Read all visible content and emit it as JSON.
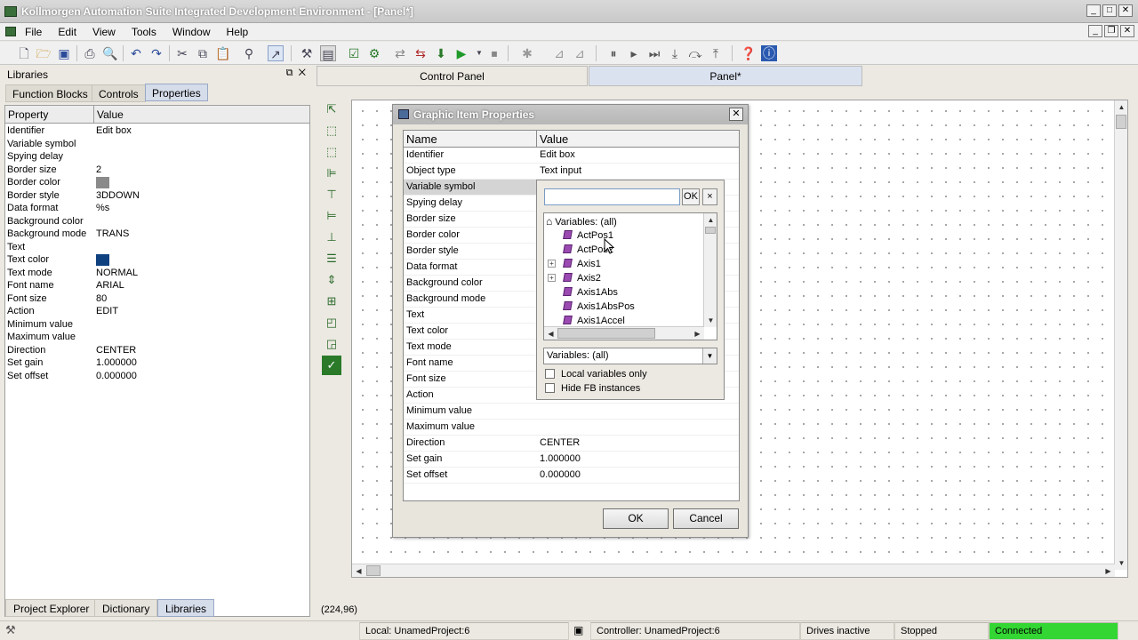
{
  "window": {
    "title": "Kollmorgen Automation Suite Integrated Development Environment - [Panel*]"
  },
  "menu": {
    "items": [
      "File",
      "Edit",
      "View",
      "Tools",
      "Window",
      "Help"
    ]
  },
  "libraries": {
    "title": "Libraries",
    "tabs": [
      "Function Blocks",
      "Controls",
      "Properties"
    ],
    "grid_headers": [
      "Property",
      "Value"
    ],
    "rows": [
      {
        "name": "Identifier",
        "value": "Edit box"
      },
      {
        "name": "Variable symbol",
        "value": ""
      },
      {
        "name": "Spying delay",
        "value": ""
      },
      {
        "name": "Border size",
        "value": "2"
      },
      {
        "name": "Border color",
        "value": ""
      },
      {
        "name": "Border style",
        "value": "3DDOWN"
      },
      {
        "name": "Data format",
        "value": "%s"
      },
      {
        "name": "Background color",
        "value": ""
      },
      {
        "name": "Background mode",
        "value": "TRANS"
      },
      {
        "name": "Text",
        "value": ""
      },
      {
        "name": "Text color",
        "value": ""
      },
      {
        "name": "Text mode",
        "value": "NORMAL"
      },
      {
        "name": "Font name",
        "value": "ARIAL"
      },
      {
        "name": "Font size",
        "value": "80"
      },
      {
        "name": "Action",
        "value": "EDIT"
      },
      {
        "name": "Minimum value",
        "value": ""
      },
      {
        "name": "Maximum value",
        "value": ""
      },
      {
        "name": "Direction",
        "value": "CENTER"
      },
      {
        "name": "Set gain",
        "value": "1.000000"
      },
      {
        "name": "Set offset",
        "value": "0.000000"
      }
    ],
    "colors": {
      "border_color": "#8a8a8a",
      "text_color": "#0f4080"
    }
  },
  "bottom_tabs": [
    "Project Explorer",
    "Dictionary",
    "Libraries"
  ],
  "doc_tabs": [
    "Control Panel",
    "Panel*"
  ],
  "coords": "(224,96)",
  "dialog": {
    "title": "Graphic Item Properties",
    "headers": [
      "Name",
      "Value"
    ],
    "rows": [
      {
        "name": "Identifier",
        "value": "Edit box"
      },
      {
        "name": "Object type",
        "value": "Text input"
      },
      {
        "name": "Variable symbol",
        "value": ""
      },
      {
        "name": "Spying delay",
        "value": ""
      },
      {
        "name": "Border size",
        "value": ""
      },
      {
        "name": "Border color",
        "value": ""
      },
      {
        "name": "Border style",
        "value": ""
      },
      {
        "name": "Data format",
        "value": ""
      },
      {
        "name": "Background color",
        "value": ""
      },
      {
        "name": "Background mode",
        "value": ""
      },
      {
        "name": "Text",
        "value": ""
      },
      {
        "name": "Text color",
        "value": ""
      },
      {
        "name": "Text mode",
        "value": ""
      },
      {
        "name": "Font name",
        "value": ""
      },
      {
        "name": "Font size",
        "value": ""
      },
      {
        "name": "Action",
        "value": ""
      },
      {
        "name": "Minimum value",
        "value": ""
      },
      {
        "name": "Maximum value",
        "value": ""
      },
      {
        "name": "Direction",
        "value": "CENTER"
      },
      {
        "name": "Set gain",
        "value": "1.000000"
      },
      {
        "name": "Set offset",
        "value": "0.000000"
      }
    ],
    "ok_label": "OK",
    "cancel_label": "Cancel"
  },
  "variable_popup": {
    "search_value": "",
    "ok_label": "OK",
    "close_label": "×",
    "tree_root": "Variables: (all)",
    "tree_items": [
      {
        "label": "ActPos1",
        "expandable": false
      },
      {
        "label": "ActPos2",
        "expandable": false
      },
      {
        "label": "Axis1",
        "expandable": true
      },
      {
        "label": "Axis2",
        "expandable": true
      },
      {
        "label": "Axis1Abs",
        "expandable": false
      },
      {
        "label": "Axis1AbsPos",
        "expandable": false
      },
      {
        "label": "Axis1Accel",
        "expandable": false
      }
    ],
    "filter_value": "Variables: (all)",
    "local_only_label": "Local variables only",
    "hide_fb_label": "Hide FB instances"
  },
  "status": {
    "local": "Local: UnamedProject:6",
    "controller": "Controller: UnamedProject:6",
    "drives": "Drives inactive",
    "state": "Stopped",
    "connection": "Connected",
    "connection_color": "#33d633"
  }
}
